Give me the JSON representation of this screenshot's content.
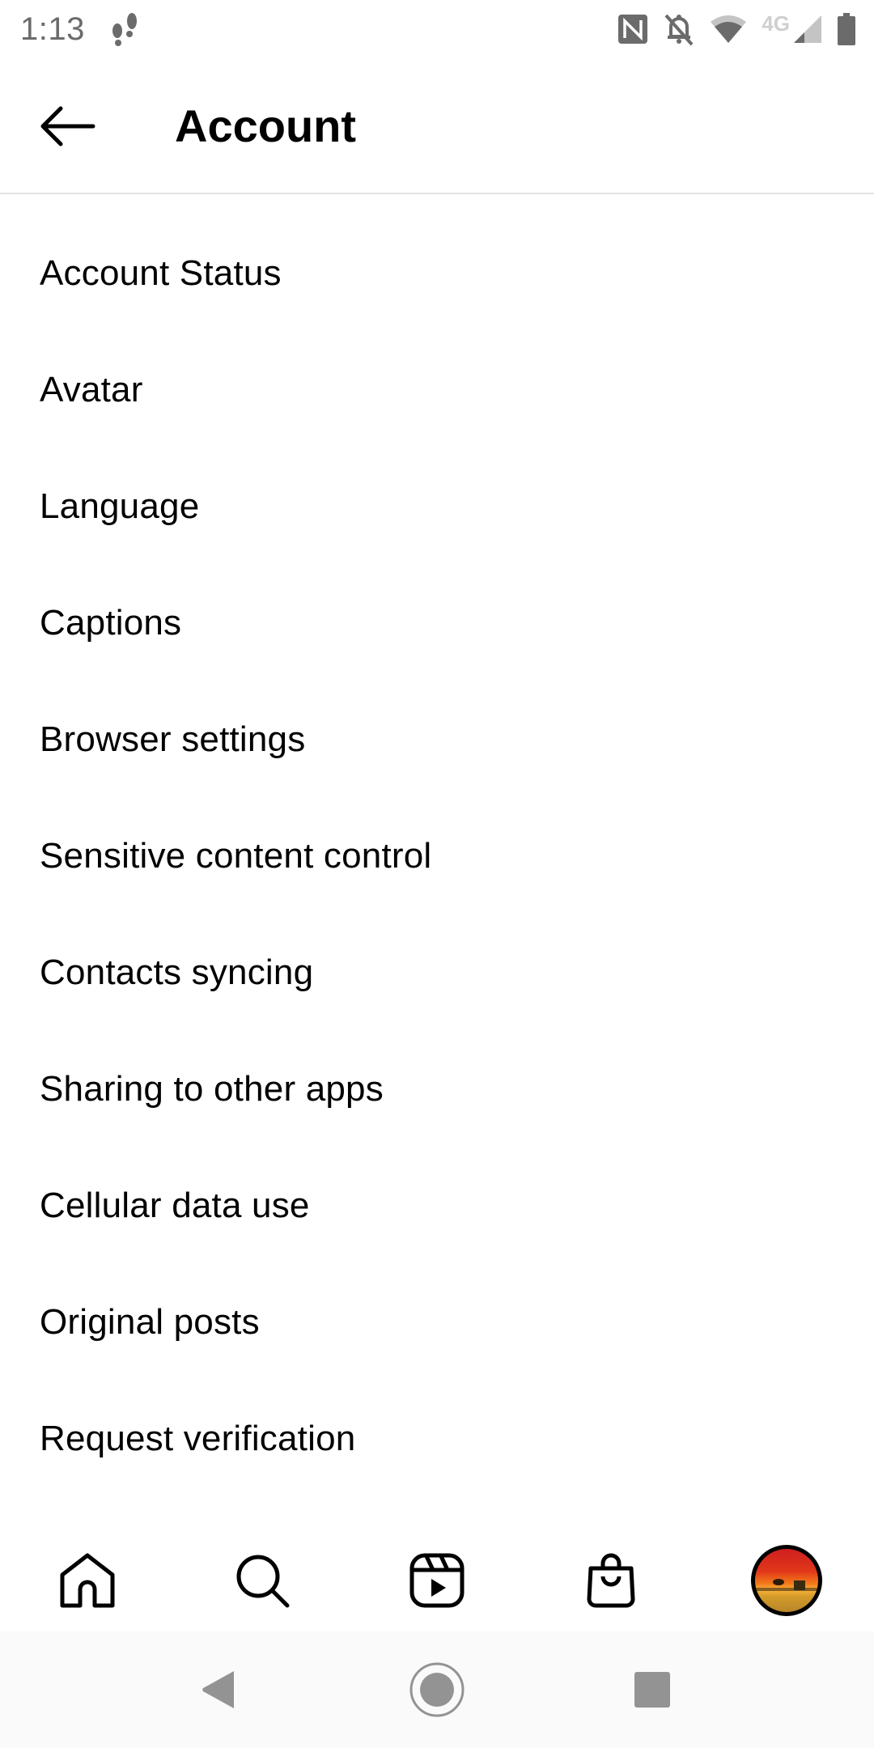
{
  "status_bar": {
    "time": "1:13",
    "left_icons": [
      "footsteps-icon"
    ],
    "right_icons": [
      "nfc-icon",
      "notifications-off-icon",
      "wifi-icon",
      "cellular-signal-icon",
      "battery-icon"
    ],
    "network_label": "4G"
  },
  "header": {
    "back_icon": "arrow-left-icon",
    "title": "Account"
  },
  "menu": {
    "items": [
      {
        "label": "Account Status"
      },
      {
        "label": "Avatar"
      },
      {
        "label": "Language"
      },
      {
        "label": "Captions"
      },
      {
        "label": "Browser settings"
      },
      {
        "label": "Sensitive content control"
      },
      {
        "label": "Contacts syncing"
      },
      {
        "label": "Sharing to other apps"
      },
      {
        "label": "Cellular data use"
      },
      {
        "label": "Original posts"
      },
      {
        "label": "Request verification"
      }
    ]
  },
  "bottom_nav": {
    "items": [
      {
        "icon": "home-icon"
      },
      {
        "icon": "search-icon"
      },
      {
        "icon": "reels-icon"
      },
      {
        "icon": "shop-bag-icon"
      },
      {
        "icon": "profile-avatar"
      }
    ]
  },
  "system_nav": {
    "items": [
      {
        "icon": "back-triangle-icon"
      },
      {
        "icon": "home-circle-icon"
      },
      {
        "icon": "recents-square-icon"
      }
    ]
  },
  "colors": {
    "text": "#000000",
    "status_icons": "#6b6b6b",
    "divider": "#e4e4e4",
    "system_nav_icon": "#939393"
  }
}
